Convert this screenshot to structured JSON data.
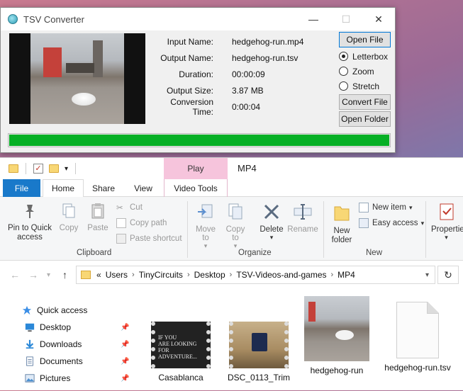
{
  "converter": {
    "title": "TSV Converter",
    "controls": {
      "minimize": "—",
      "maximize": "☐",
      "close": "✕"
    },
    "fields": [
      {
        "label": "Input Name:",
        "value": "hedgehog-run.mp4"
      },
      {
        "label": "Output Name:",
        "value": "hedgehog-run.tsv"
      },
      {
        "label": "Duration:",
        "value": "00:00:09"
      },
      {
        "label": "Output Size:",
        "value": "3.87 MB"
      },
      {
        "label": "Conversion Time:",
        "value": "0:00:04"
      }
    ],
    "open_file": "Open File",
    "scale_options": [
      "Letterbox",
      "Zoom",
      "Stretch"
    ],
    "selected_scale": "Letterbox",
    "convert_file": "Convert File",
    "open_folder": "Open Folder",
    "progress": 1.0,
    "progress_color": "#06b025"
  },
  "explorer": {
    "context_tab": "Play",
    "window_title": "MP4",
    "tabs": [
      "File",
      "Home",
      "Share",
      "View",
      "Video Tools"
    ],
    "ribbon": {
      "pin_to_quick_access": "Pin to Quick access",
      "copy": "Copy",
      "paste": "Paste",
      "cut": "Cut",
      "copy_path": "Copy path",
      "paste_shortcut": "Paste shortcut",
      "clipboard_group": "Clipboard",
      "move_to": "Move to",
      "copy_to": "Copy to",
      "delete": "Delete",
      "rename": "Rename",
      "organize_group": "Organize",
      "new_folder": "New folder",
      "new_item": "New item",
      "easy_access": "Easy access",
      "new_group": "New",
      "properties": "Properties"
    },
    "address": {
      "prefix": "«",
      "crumbs": [
        "Users",
        "TinyCircuits",
        "Desktop",
        "TSV-Videos-and-games",
        "MP4"
      ]
    },
    "nav": [
      {
        "label": "Quick access",
        "icon": "star-icon"
      },
      {
        "label": "Desktop",
        "icon": "desktop-icon"
      },
      {
        "label": "Downloads",
        "icon": "download-icon"
      },
      {
        "label": "Documents",
        "icon": "documents-icon"
      },
      {
        "label": "Pictures",
        "icon": "pictures-icon"
      }
    ],
    "files": [
      {
        "name": "Casablanca",
        "kind": "video",
        "caption_lines": [
          "IF YOU",
          "ARE LOOKING FOR",
          "ADVENTURE..."
        ]
      },
      {
        "name": "DSC_0113_Trim",
        "kind": "video"
      },
      {
        "name": "hedgehog-run",
        "kind": "video"
      },
      {
        "name": "hedgehog-run.tsv",
        "kind": "document"
      }
    ]
  }
}
